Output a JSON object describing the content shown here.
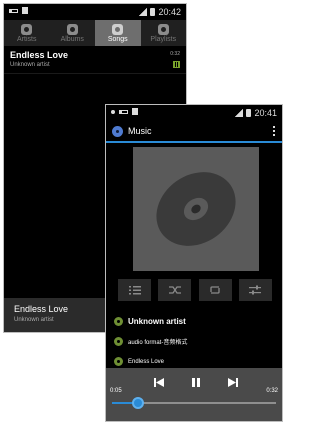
{
  "back": {
    "status": {
      "time": "20:42"
    },
    "tabs": [
      {
        "label": "Artists",
        "icon": "microphone-icon",
        "active": false
      },
      {
        "label": "Albums",
        "icon": "album-icon",
        "active": false
      },
      {
        "label": "Songs",
        "icon": "music-note-icon",
        "active": true
      },
      {
        "label": "Playlists",
        "icon": "playlist-icon",
        "active": false
      }
    ],
    "songs": [
      {
        "title": "Endless Love",
        "artist": "Unknown artist",
        "duration": "0:32"
      }
    ],
    "now_playing": {
      "title": "Endless Love",
      "artist": "Unknown artist"
    }
  },
  "front": {
    "status": {
      "time": "20:41"
    },
    "app_title": "Music",
    "artist": "Unknown artist",
    "album": "audio format-音频格式",
    "song": "Endless Love",
    "time_elapsed": "0:05",
    "time_total": "0:32",
    "progress": 0.16,
    "accent_color": "#2a8bd6",
    "controls": [
      "playlist-icon",
      "shuffle-icon",
      "repeat-icon",
      "equalizer-icon"
    ],
    "transport": [
      "previous-icon",
      "pause-icon",
      "next-icon"
    ]
  }
}
